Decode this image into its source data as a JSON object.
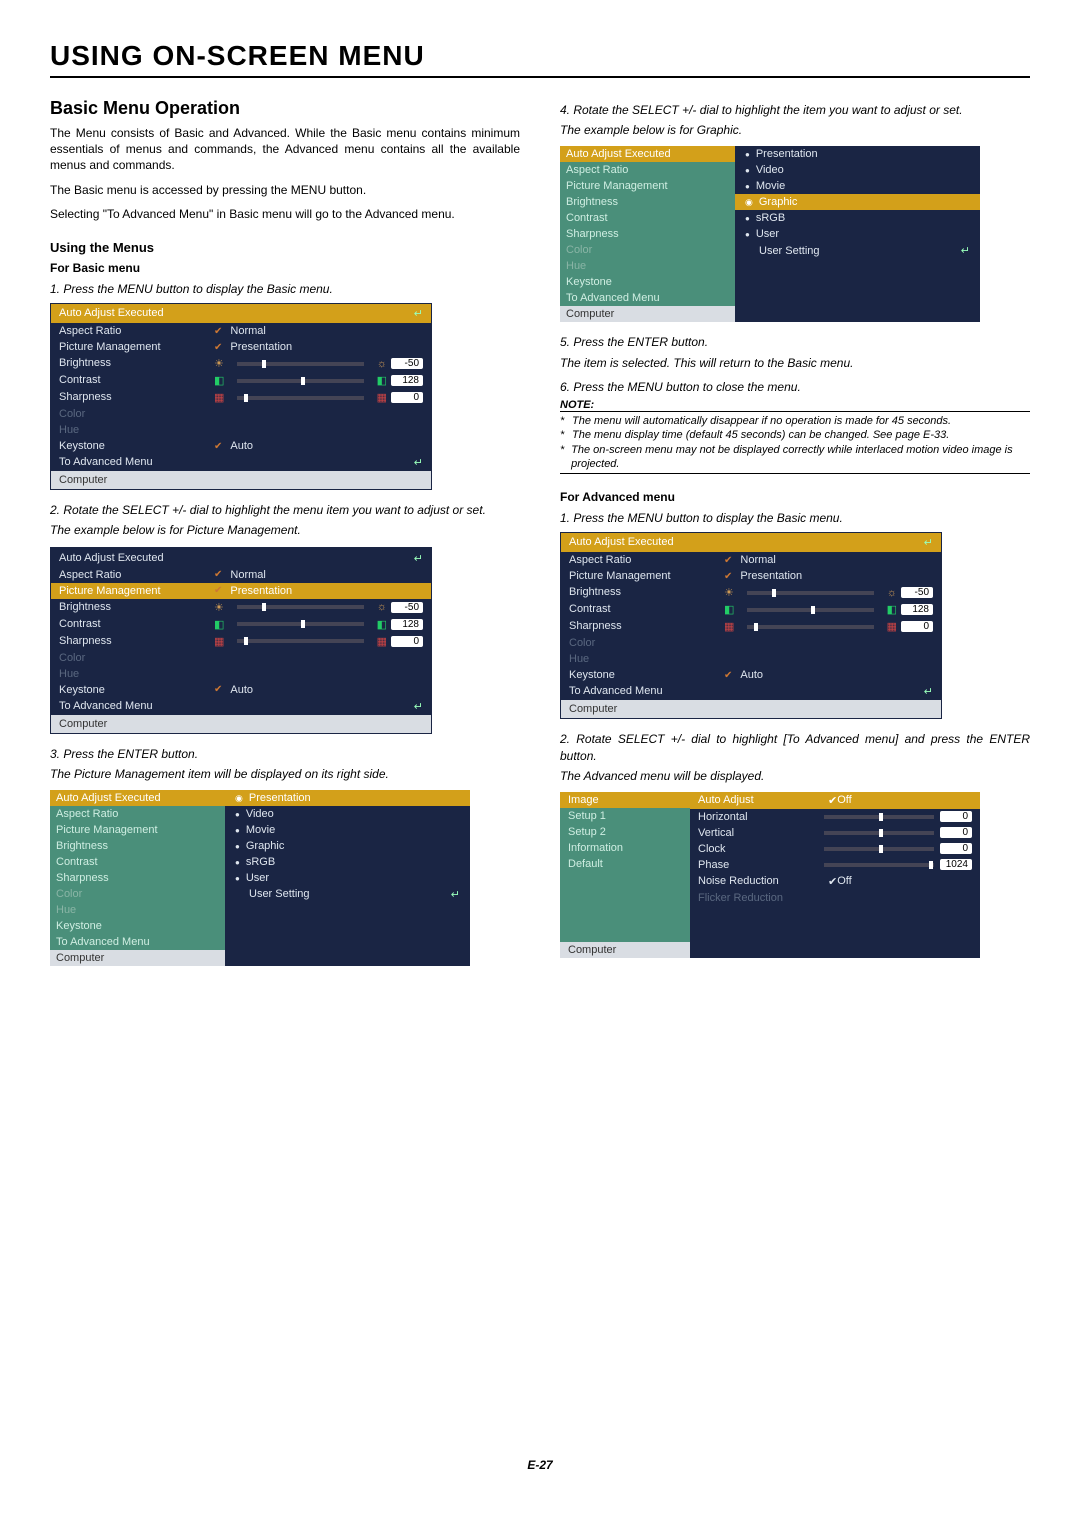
{
  "title": "USING ON-SCREEN MENU",
  "section": "Basic Menu Operation",
  "intro1": "The Menu consists of Basic and Advanced. While the Basic menu contains minimum essentials of menus and commands, the Advanced menu contains all the available menus and commands.",
  "intro2a": "The Basic menu is accessed by pressing the MENU button.",
  "intro2b": "Selecting \"To Advanced Menu\" in Basic menu will go to the Advanced menu.",
  "using_menus": "Using the Menus",
  "for_basic": "For Basic menu",
  "for_advanced": "For Advanced menu",
  "steps": {
    "b1": "1. Press the MENU button to display the Basic menu.",
    "b2": "2. Rotate the SELECT +/- dial to highlight the menu item you want to adjust or set.",
    "b2c": "The example below is for Picture Management.",
    "b3": "3. Press the ENTER button.",
    "b3c": "The Picture Management item will be displayed on its right side.",
    "b4": "4. Rotate the SELECT +/- dial to highlight the item you want to adjust or set.",
    "b4c": "The example below is for Graphic.",
    "b5": "5. Press the ENTER button.",
    "b5c": "The item is selected. This will return to the Basic menu.",
    "b6": "6. Press the MENU button to close the menu.",
    "a1": "1. Press the MENU button to display the Basic menu.",
    "a2": "2. Rotate SELECT +/- dial to highlight [To Advanced menu] and press the ENTER button.",
    "a2c": "The Advanced menu will be displayed."
  },
  "note_label": "NOTE:",
  "notes": {
    "n1": "The menu will automatically disappear if no operation is made for 45 seconds.",
    "n2": "The menu display time (default 45 seconds) can be changed. See page E-33.",
    "n3": "The on-screen menu may not be displayed correctly while interlaced motion video image is projected."
  },
  "page_num": "E-27",
  "osd": {
    "header": "Auto Adjust Executed",
    "items": {
      "aspect": "Aspect Ratio",
      "picmgmt": "Picture Management",
      "brightness": "Brightness",
      "contrast": "Contrast",
      "sharpness": "Sharpness",
      "color": "Color",
      "hue": "Hue",
      "keystone": "Keystone",
      "toadv": "To Advanced Menu",
      "computer": "Computer"
    },
    "vals": {
      "normal": "Normal",
      "presentation": "Presentation",
      "auto": "Auto",
      "brightness": "-50",
      "contrast": "128",
      "sharpness": "0"
    },
    "enter": "↵"
  },
  "submenu": {
    "presentation": "Presentation",
    "video": "Video",
    "movie": "Movie",
    "graphic": "Graphic",
    "srgb": "sRGB",
    "user": "User",
    "usersetting": "User Setting"
  },
  "adv": {
    "left": {
      "image": "Image",
      "setup1": "Setup 1",
      "setup2": "Setup 2",
      "information": "Information",
      "default": "Default",
      "computer": "Computer"
    },
    "right": {
      "autoadj": "Auto Adjust",
      "horizontal": "Horizontal",
      "vertical": "Vertical",
      "clock": "Clock",
      "phase": "Phase",
      "noise": "Noise Reduction",
      "flicker": "Flicker Reduction",
      "off": "Off",
      "v0": "0",
      "v1024": "1024"
    }
  }
}
